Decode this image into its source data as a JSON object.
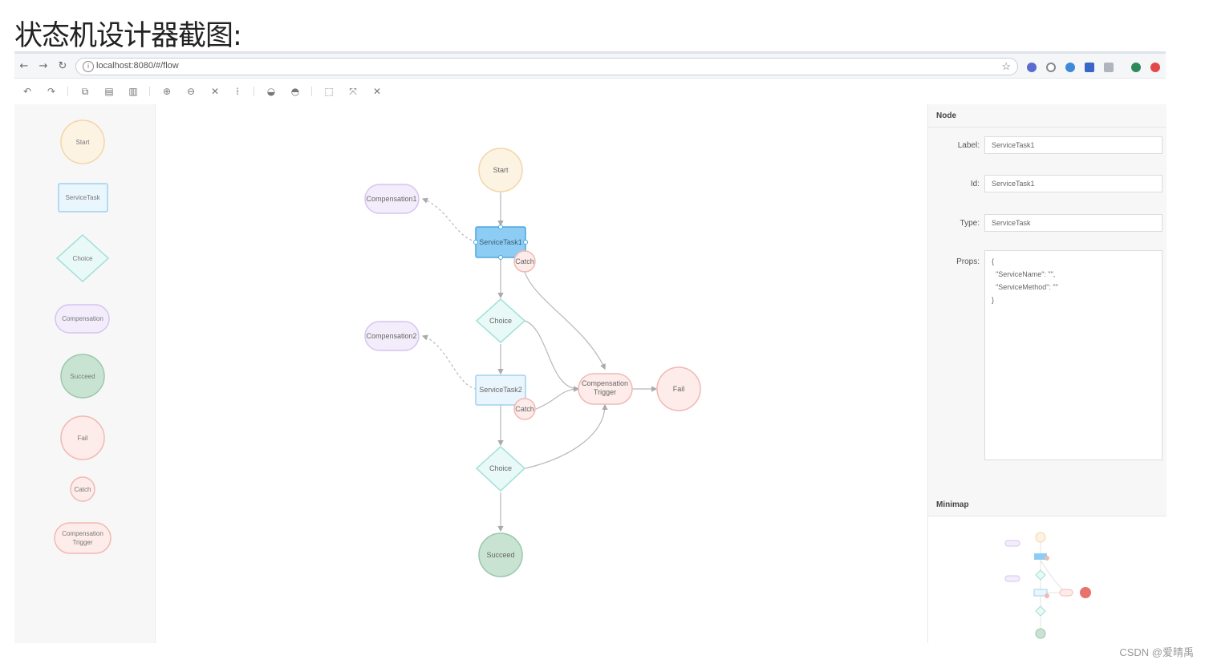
{
  "heading": "状态机设计器截图:",
  "browser": {
    "url": "localhost:8080/#/flow",
    "extensions": [
      "#5a6bd1",
      "#ffffff",
      "#3d8bd6",
      "#3a66c9",
      "#b0b5bd",
      "#2e8a5a",
      "#e24a4a"
    ]
  },
  "palette": {
    "items": [
      {
        "label": "Start",
        "shape": "circle"
      },
      {
        "label": "ServiceTask",
        "shape": "rect"
      },
      {
        "label": "Choice",
        "shape": "diamond"
      },
      {
        "label": "Compensation",
        "shape": "pill"
      },
      {
        "label": "Succeed",
        "shape": "circle"
      },
      {
        "label": "Fail",
        "shape": "circle"
      },
      {
        "label": "Catch",
        "shape": "small-circle"
      },
      {
        "label_line1": "Compensation",
        "label_line2": "Trigger",
        "shape": "pill"
      }
    ]
  },
  "canvas": {
    "nodes": {
      "start": "Start",
      "service_task_1": "ServiceTask1",
      "catch_1": "Catch",
      "compensation_1": "Compensation1",
      "choice_1": "Choice",
      "compensation_2": "Compensation2",
      "service_task_2": "ServiceTask2",
      "catch_2": "Catch",
      "compensation_trigger_line1": "Compensation",
      "compensation_trigger_line2": "Trigger",
      "fail": "Fail",
      "choice_2": "Choice",
      "succeed": "Succeed"
    },
    "selected_node": "ServiceTask1"
  },
  "panel": {
    "node_title": "Node",
    "label_caption": "Label:",
    "label_value": "ServiceTask1",
    "id_caption": "Id:",
    "id_value": "ServiceTask1",
    "type_caption": "Type:",
    "type_value": "ServiceTask",
    "props_caption": "Props:",
    "props_value": "{\n  \"ServiceName\": \"\",\n  \"ServiceMethod\": \"\"\n}",
    "minimap_title": "Minimap"
  },
  "colors": {
    "start": "#fdf3e3",
    "start_border": "#f3d6a8",
    "task": "#eaf6fd",
    "task_border": "#9fd1ee",
    "task_selected": "#8ecdf3",
    "task_selected_border": "#4aa6e0",
    "choice": "#e8f9f7",
    "choice_border": "#9fe0d6",
    "compensation": "#f3edfb",
    "compensation_border": "#d6c4ef",
    "succeed": "#c8e3d2",
    "succeed_border": "#9cc8ad",
    "fail": "#fdecea",
    "fail_border": "#f0b9b3"
  },
  "watermark": "CSDN @爱晴禹"
}
